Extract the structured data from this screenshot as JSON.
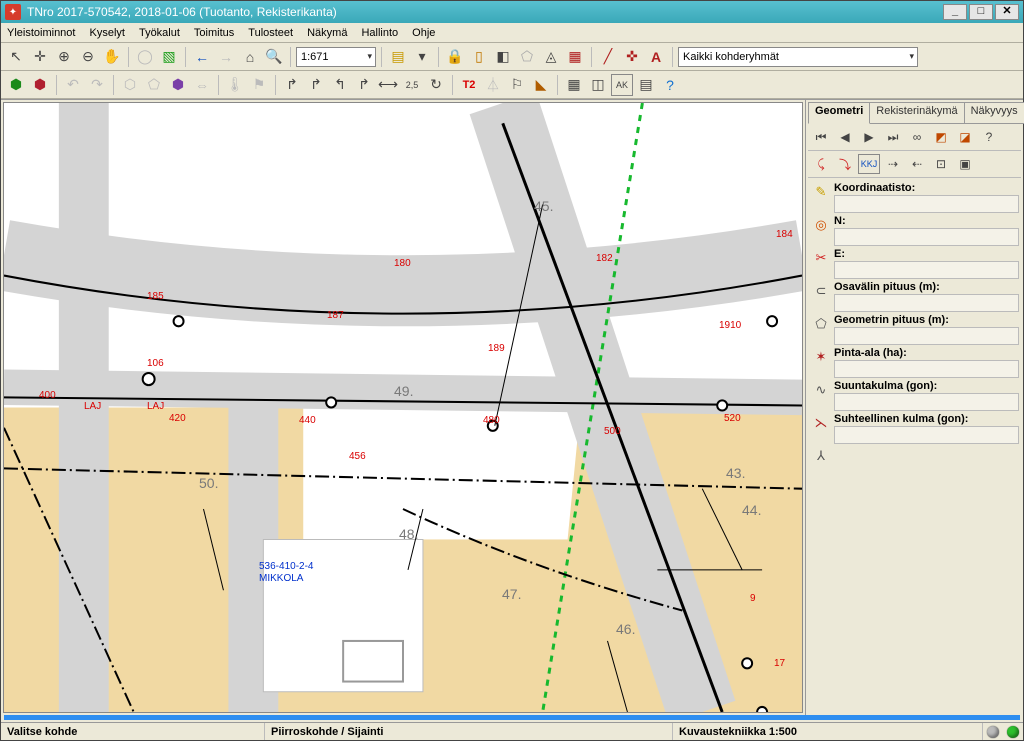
{
  "title": "TNro 2017-570542, 2018-01-06 (Tuotanto, Rekisterikanta)",
  "menu": [
    "Yleistoiminnot",
    "Kyselyt",
    "Työkalut",
    "Toimitus",
    "Tulosteet",
    "Näkymä",
    "Hallinto",
    "Ohje"
  ],
  "toolbar1": {
    "scale": "1:671",
    "target_group": "Kaikki kohderyhmät"
  },
  "toolbar2": {
    "label_t2": "T2"
  },
  "side": {
    "tabs": [
      "Geometri",
      "Rekisterinäkymä",
      "Näkyvyys"
    ],
    "nav_btn_kkj": "KKJ",
    "fields": {
      "koordinaatisto": "Koordinaatisto:",
      "n": "N:",
      "e": "E:",
      "osavali": "Osavälin pituus (m):",
      "geom": "Geometrin pituus (m):",
      "pinta": "Pinta-ala (ha):",
      "suunta": "Suuntakulma (gon):",
      "suht": "Suhteellinen kulma (gon):"
    }
  },
  "status": {
    "left": "Valitse kohde",
    "center": "Piirroskohde / Sijainti",
    "right": "Kuvaustekniikka 1:500"
  },
  "map_labels": {
    "p45": "45.",
    "p49": "49.",
    "p50": "50.",
    "p48": "48.",
    "p47": "47.",
    "p46": "46.",
    "p43": "43.",
    "p44": "44.",
    "r180": "180",
    "r182": "182",
    "r184": "184",
    "r185": "185",
    "r187": "187",
    "r189": "189",
    "r1910": "1910",
    "r106": "106",
    "r400": "400",
    "r420": "420",
    "r440": "440",
    "r456": "456",
    "r480": "480",
    "r500": "500",
    "r520": "520",
    "r9": "9",
    "r17": "17",
    "laj1": "LAJ",
    "laj2": "LAJ",
    "parcel": "536-410-2-4",
    "parcel_name": "MIKKOLA"
  }
}
